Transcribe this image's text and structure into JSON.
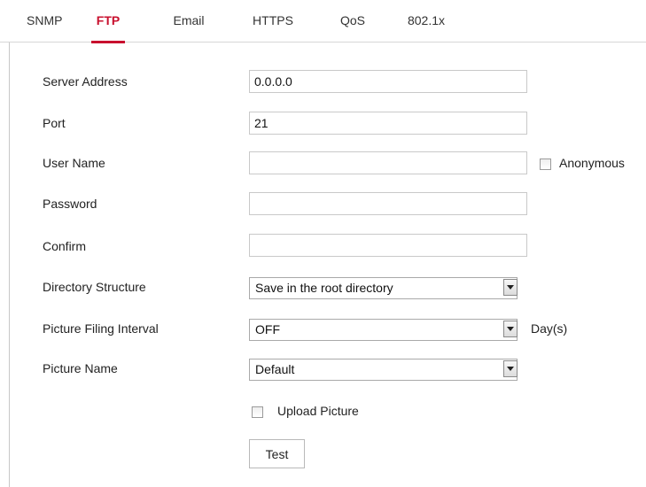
{
  "tabs": [
    {
      "label": "SNMP",
      "active": false
    },
    {
      "label": "FTP",
      "active": true
    },
    {
      "label": "Email",
      "active": false
    },
    {
      "label": "HTTPS",
      "active": false
    },
    {
      "label": "QoS",
      "active": false
    },
    {
      "label": "802.1x",
      "active": false
    }
  ],
  "accent_color": "#c8102e",
  "form": {
    "server_address": {
      "label": "Server Address",
      "value": "0.0.0.0"
    },
    "port": {
      "label": "Port",
      "value": "21"
    },
    "user_name": {
      "label": "User Name",
      "value": ""
    },
    "anonymous": {
      "label": "Anonymous",
      "checked": false
    },
    "password": {
      "label": "Password",
      "value": ""
    },
    "confirm": {
      "label": "Confirm",
      "value": ""
    },
    "directory_structure": {
      "label": "Directory Structure",
      "selected": "Save in the root directory"
    },
    "picture_filing_interval": {
      "label": "Picture Filing Interval",
      "selected": "OFF",
      "unit": "Day(s)"
    },
    "picture_name": {
      "label": "Picture Name",
      "selected": "Default"
    },
    "upload_picture": {
      "label": "Upload Picture",
      "checked": false
    },
    "test_button": "Test"
  }
}
